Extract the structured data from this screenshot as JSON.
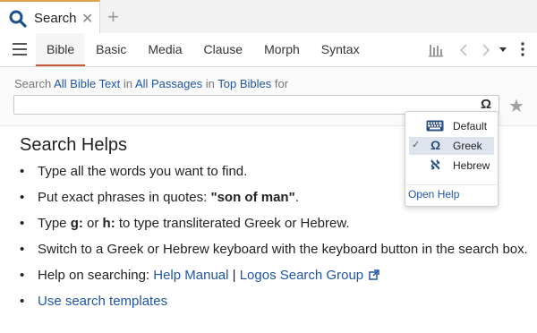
{
  "tab": {
    "label": "Search",
    "close": "✕",
    "new_tab": "+"
  },
  "toolbar": {
    "tabs": [
      "Bible",
      "Basic",
      "Media",
      "Clause",
      "Morph",
      "Syntax"
    ]
  },
  "crumbs": {
    "prefix": "Search",
    "scope1": "All Bible Text",
    "in1": "in",
    "scope2": "All Passages",
    "in2": "in",
    "scope3": "Top Bibles",
    "suffix": "for"
  },
  "search": {
    "value": "",
    "keyboard_glyph": "Ω"
  },
  "dropdown": {
    "items": [
      {
        "label": "Default",
        "icon": "keyboard-icon"
      },
      {
        "label": "Greek",
        "icon": "omega-icon",
        "checked": true
      },
      {
        "label": "Hebrew",
        "icon": "aleph-icon"
      }
    ],
    "link": "Open Help"
  },
  "helps": {
    "title": "Search Helps",
    "b1": "Type all the words you want to find.",
    "b2_pre": "Put exact phrases in quotes: ",
    "b2_bold": "\"son of man\"",
    "b2_post": ".",
    "b3_pre": "Type ",
    "b3_g": "g:",
    "b3_mid": " or ",
    "b3_h": "h:",
    "b3_post": " to type transliterated Greek or Hebrew.",
    "b4": "Switch to a Greek or Hebrew keyboard with the keyboard button in the search box.",
    "b5_pre": "Help on searching: ",
    "b5_link1": "Help Manual",
    "b5_sep": " | ",
    "b5_link2": "Logos Search Group",
    "b6": "Use search templates"
  },
  "colors": {
    "accent_tab": "#e0a24a",
    "active_underline": "#c45a3a",
    "link": "#2155a3"
  }
}
